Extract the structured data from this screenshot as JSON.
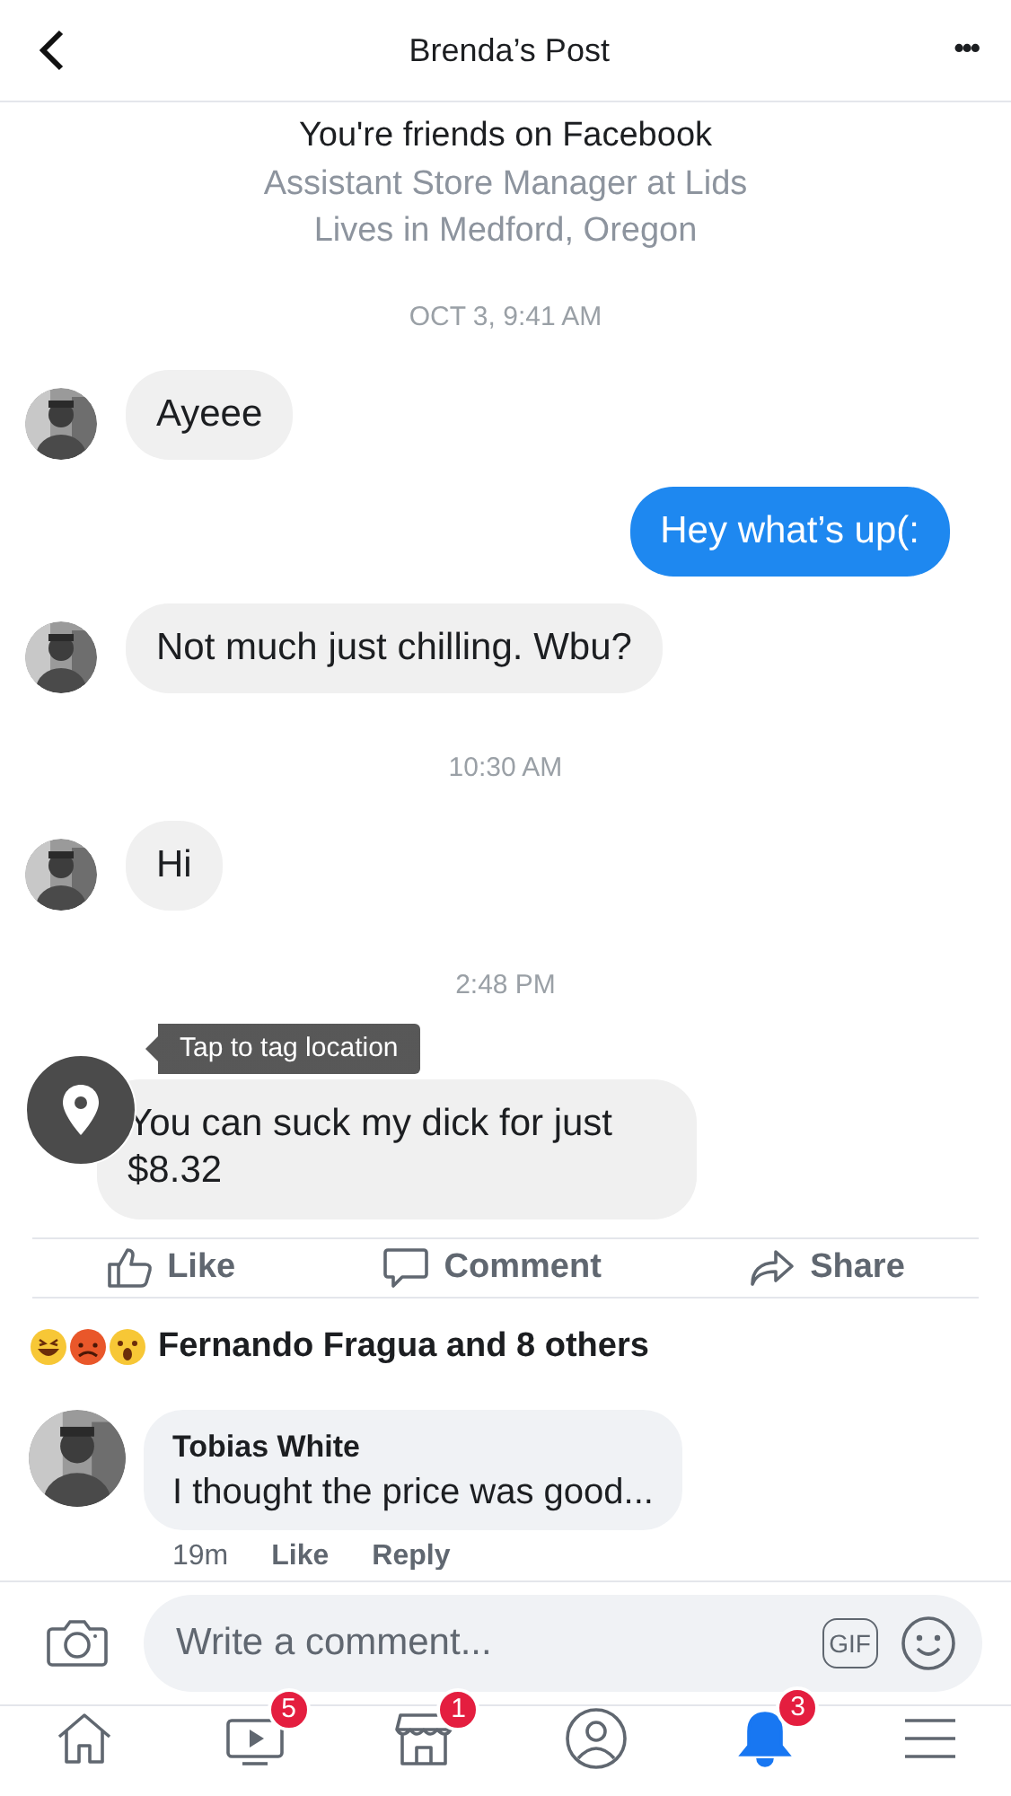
{
  "header": {
    "title": "Brenda’s Post",
    "more": "•••"
  },
  "profile_info": {
    "friends": "You're friends on Facebook",
    "job": "Assistant Store Manager at Lids",
    "location": "Lives in Medford, Oregon"
  },
  "messages": [
    {
      "kind": "time",
      "text": "OCT 3, 9:41 AM"
    },
    {
      "kind": "incoming",
      "text": "Ayeee"
    },
    {
      "kind": "outgoing",
      "text": "Hey what’s up(:"
    },
    {
      "kind": "incoming",
      "text": "Not much just chilling. Wbu?"
    },
    {
      "kind": "time",
      "text": "10:30 AM"
    },
    {
      "kind": "incoming",
      "text": "Hi"
    },
    {
      "kind": "time",
      "text": "2:48 PM"
    },
    {
      "kind": "incoming_tagged",
      "text": "You can suck my dick for just $8.32"
    }
  ],
  "tooltip": "Tap to tag location",
  "actions": [
    {
      "kind": "like",
      "label": "Like"
    },
    {
      "kind": "comment",
      "label": "Comment"
    },
    {
      "kind": "share",
      "label": "Share"
    }
  ],
  "reactions": {
    "text": "Fernando Fragua and 8 others"
  },
  "comment": {
    "author": "Tobias White",
    "text": "I thought the price was good...",
    "time": "19m",
    "like": "Like",
    "reply": "Reply"
  },
  "composer": {
    "placeholder": "Write a comment...",
    "gif": "GIF"
  },
  "tabbar": [
    {
      "kind": "home",
      "selected": false
    },
    {
      "kind": "video",
      "badge": "5",
      "selected": false
    },
    {
      "kind": "marketplace",
      "badge": "1",
      "selected": false
    },
    {
      "kind": "profile",
      "selected": false
    },
    {
      "kind": "notifications",
      "badge": "3",
      "selected": true
    },
    {
      "kind": "menu",
      "selected": false
    }
  ]
}
